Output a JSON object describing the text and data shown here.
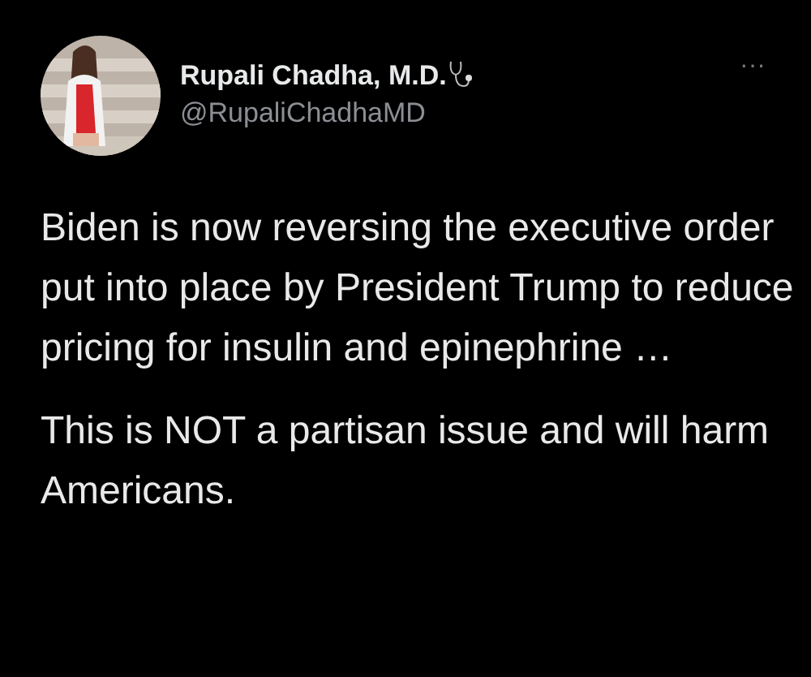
{
  "tweet": {
    "author_name": "Rupali Chadha, M.D.",
    "handle": "@RupaliChadhaMD",
    "more": "···",
    "paragraphs": [
      "Biden is now reversing the executive order put into place by President Trump to reduce pricing for insulin and epinephrine …",
      "This is NOT a partisan issue and will harm Americans."
    ]
  }
}
